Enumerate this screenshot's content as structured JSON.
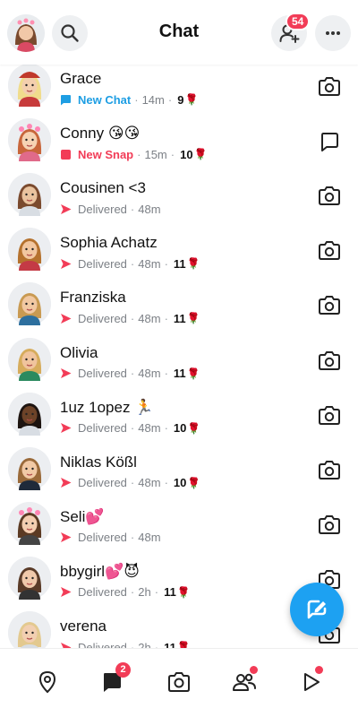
{
  "header": {
    "title": "Chat",
    "friend_requests_badge": "54"
  },
  "chats": [
    {
      "name": "Grace",
      "status": "New Chat",
      "status_kind": "new-chat",
      "time": "14m",
      "streak": "9",
      "streak_emoji": "🌹",
      "action": "camera"
    },
    {
      "name": "Conny 😘😘",
      "status": "New Snap",
      "status_kind": "new-snap",
      "time": "15m",
      "streak": "10",
      "streak_emoji": "🌹",
      "action": "chat"
    },
    {
      "name": "Cousinen <3",
      "status": "Delivered",
      "status_kind": "delivered",
      "time": "48m",
      "streak": "",
      "streak_emoji": "",
      "action": "camera"
    },
    {
      "name": "Sophia Achatz",
      "status": "Delivered",
      "status_kind": "delivered",
      "time": "48m",
      "streak": "11",
      "streak_emoji": "🌹",
      "action": "camera"
    },
    {
      "name": "Franziska",
      "status": "Delivered",
      "status_kind": "delivered",
      "time": "48m",
      "streak": "11",
      "streak_emoji": "🌹",
      "action": "camera"
    },
    {
      "name": "Olivia",
      "status": "Delivered",
      "status_kind": "delivered",
      "time": "48m",
      "streak": "11",
      "streak_emoji": "🌹",
      "action": "camera"
    },
    {
      "name": "1uz 1opez 🏃",
      "status": "Delivered",
      "status_kind": "delivered",
      "time": "48m",
      "streak": "10",
      "streak_emoji": "🌹",
      "action": "camera"
    },
    {
      "name": "Niklas Kößl",
      "status": "Delivered",
      "status_kind": "delivered",
      "time": "48m",
      "streak": "10",
      "streak_emoji": "🌹",
      "action": "camera"
    },
    {
      "name": "Seli💕",
      "status": "Delivered",
      "status_kind": "delivered",
      "time": "48m",
      "streak": "",
      "streak_emoji": "",
      "action": "camera"
    },
    {
      "name": "bbygirl💕😈",
      "status": "Delivered",
      "status_kind": "delivered",
      "time": "2h",
      "streak": "11",
      "streak_emoji": "🌹",
      "action": "camera"
    },
    {
      "name": "verena",
      "status": "Delivered",
      "status_kind": "delivered",
      "time": "2h",
      "streak": "11",
      "streak_emoji": "🌹",
      "action": "camera"
    }
  ],
  "nav": {
    "chat_badge": "2"
  },
  "colors": {
    "accent_blue": "#1e9ee3",
    "accent_red": "#f23c57",
    "fab": "#1da1f2",
    "text_grey": "#7c8086"
  },
  "icons": [
    "search-icon",
    "add-friend-icon",
    "more-icon",
    "camera-icon",
    "chat-bubble-icon",
    "map-pin-icon",
    "friends-icon",
    "stories-play-icon",
    "new-chat-icon"
  ]
}
